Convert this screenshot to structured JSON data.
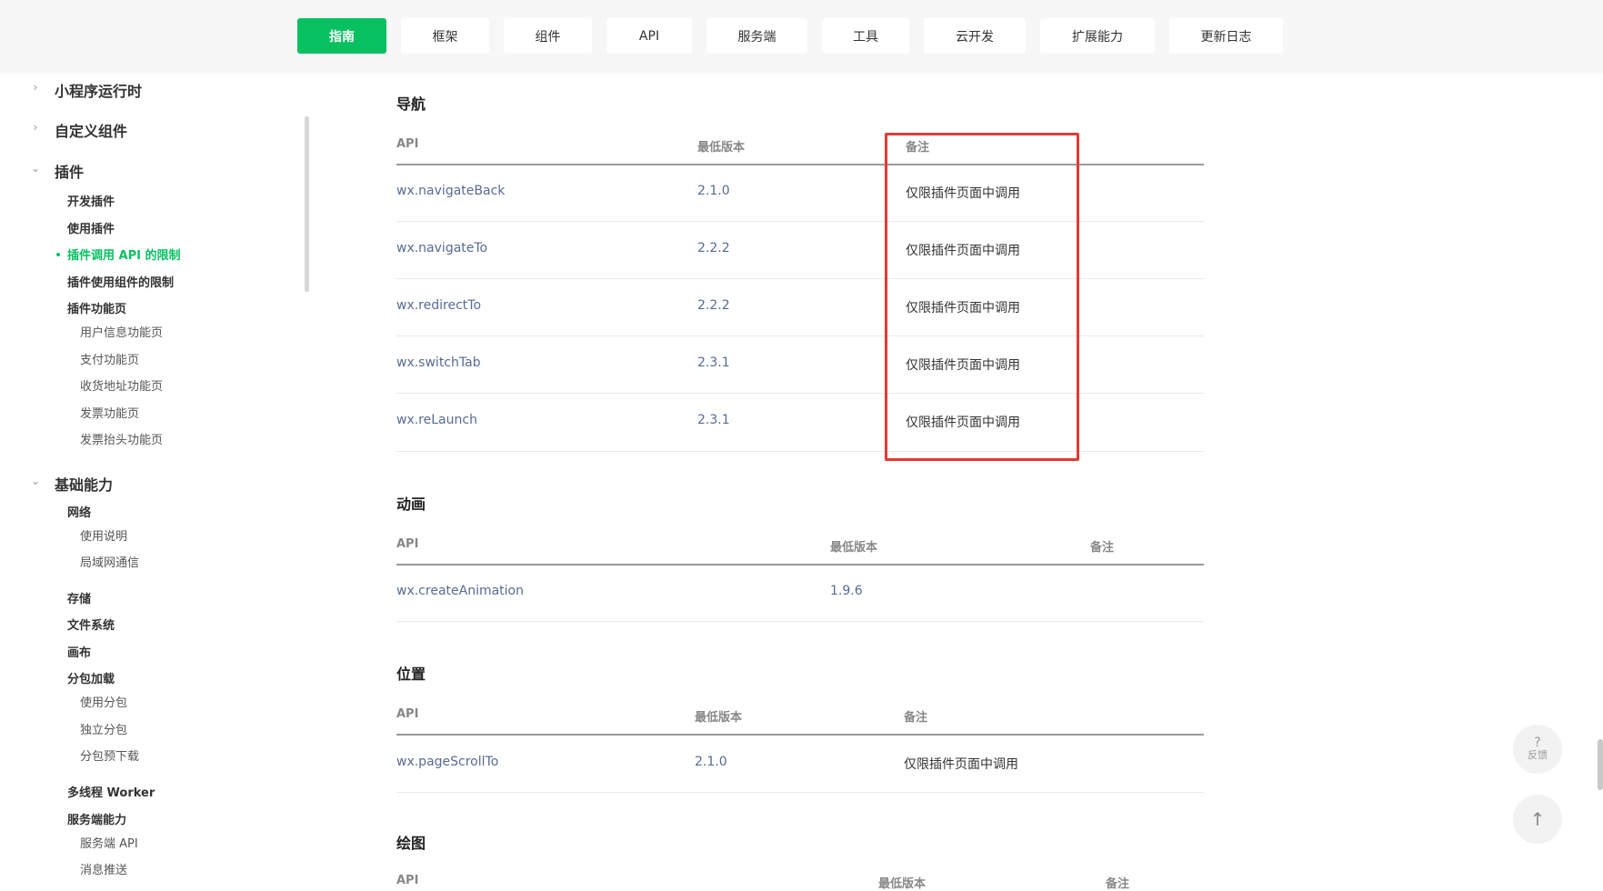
{
  "nav": {
    "items": [
      "指南",
      "框架",
      "组件",
      "API",
      "服务端",
      "工具",
      "云开发",
      "扩展能力",
      "更新日志"
    ],
    "active": "指南"
  },
  "sidebar": {
    "runtime": "小程序运行时",
    "custom_component": "自定义组件",
    "plugin": "插件",
    "plugin_dev": "开发插件",
    "plugin_use": "使用插件",
    "plugin_api_limit": "插件调用 API 的限制",
    "plugin_component_limit": "插件使用组件的限制",
    "plugin_pages": "插件功能页",
    "user_info_page": "用户信息功能页",
    "payment_page": "支付功能页",
    "address_page": "收货地址功能页",
    "invoice_page": "发票功能页",
    "invoice_title_page": "发票抬头功能页",
    "basic": "基础能力",
    "network": "网络",
    "usage": "使用说明",
    "lan": "局域网通信",
    "storage": "存储",
    "filesystem": "文件系统",
    "canvas": "画布",
    "subpackage": "分包加载",
    "use_subpackage": "使用分包",
    "independent_subpackage": "独立分包",
    "subpackage_preload": "分包预下载",
    "worker": "多线程 Worker",
    "server": "服务端能力",
    "server_api": "服务端 API",
    "message_push": "消息推送"
  },
  "sections": {
    "nav": {
      "title": "导航",
      "headers": [
        "API",
        "最低版本",
        "备注"
      ],
      "rows": [
        {
          "api": "wx.navigateBack",
          "version": "2.1.0",
          "note": "仅限插件页面中调用"
        },
        {
          "api": "wx.navigateTo",
          "version": "2.2.2",
          "note": "仅限插件页面中调用"
        },
        {
          "api": "wx.redirectTo",
          "version": "2.2.2",
          "note": "仅限插件页面中调用"
        },
        {
          "api": "wx.switchTab",
          "version": "2.3.1",
          "note": "仅限插件页面中调用"
        },
        {
          "api": "wx.reLaunch",
          "version": "2.3.1",
          "note": "仅限插件页面中调用"
        }
      ]
    },
    "anim": {
      "title": "动画",
      "headers": [
        "API",
        "最低版本",
        "备注"
      ],
      "rows": [
        {
          "api": "wx.createAnimation",
          "version": "1.9.6",
          "note": ""
        }
      ]
    },
    "pos": {
      "title": "位置",
      "headers": [
        "API",
        "最低版本",
        "备注"
      ],
      "rows": [
        {
          "api": "wx.pageScrollTo",
          "version": "2.1.0",
          "note": "仅限插件页面中调用"
        }
      ]
    },
    "draw": {
      "title": "绘图",
      "headers": [
        "API",
        "最低版本",
        "备注"
      ]
    }
  },
  "fab": {
    "feedback_icon": "?",
    "feedback_label": "反馈",
    "top_icon": "↑"
  },
  "colors": {
    "accent": "#07c160",
    "link": "#576b95",
    "highlight": "#e53935"
  }
}
